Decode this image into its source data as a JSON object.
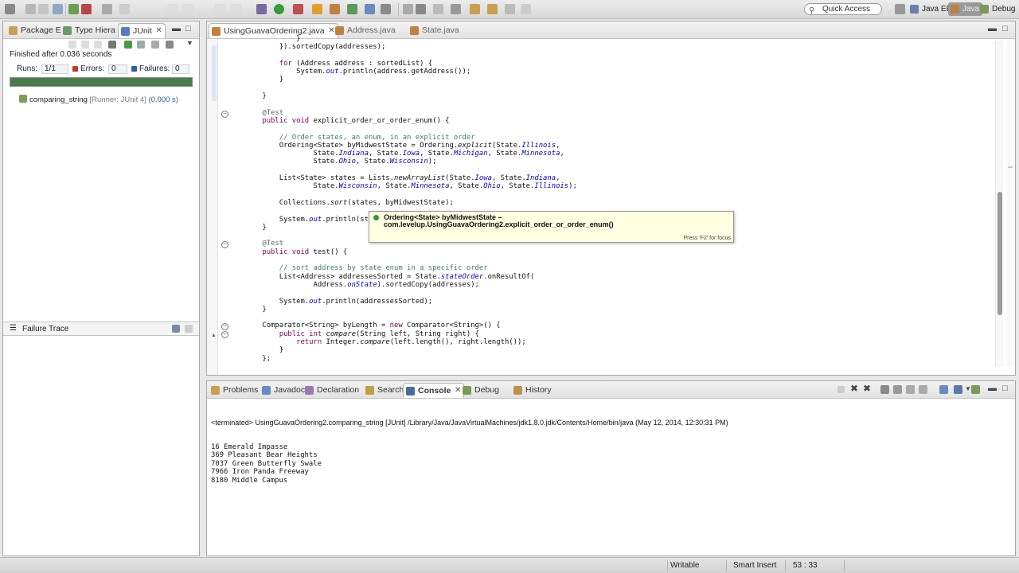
{
  "toolbar": {
    "quick_access_placeholder": "Quick Access",
    "perspectives": [
      {
        "label": "Java EE",
        "icon": "java-ee-icon"
      },
      {
        "label": "Java",
        "icon": "java-perspective-icon"
      },
      {
        "label": "Debug",
        "icon": "debug-perspective-icon"
      }
    ]
  },
  "junit_panel": {
    "tabs": [
      {
        "label": "Package E"
      },
      {
        "label": "Type Hiera"
      },
      {
        "label": "JUnit"
      }
    ],
    "status": "Finished after 0.036 seconds",
    "runs_label": "Runs:",
    "runs_value": "1/1",
    "errors_label": "Errors:",
    "errors_value": "0",
    "failures_label": "Failures:",
    "failures_value": "0",
    "progress": 1.0,
    "progress_color": "#4d7a4d",
    "test_name": "comparing_string",
    "test_meta": "[Runner: JUnit 4]",
    "test_time": "(0.000 s)",
    "failure_trace_label": "Failure Trace"
  },
  "editor": {
    "tabs": [
      {
        "label": "UsingGuavaOrdering2.java"
      },
      {
        "label": "Address.java"
      },
      {
        "label": "State.java"
      }
    ],
    "lines": [
      "            }",
      "        }).sortedCopy(addresses);",
      "",
      "        for (Address address : sortedList) {",
      "            System.out.println(address.getAddress());",
      "        }",
      "",
      "    }",
      "",
      "    @Test",
      "    public void explicit_order_or_order_enum() {",
      "",
      "        // Order states, an enum, in an explicit order",
      "        Ordering<State> byMidwestState = Ordering.explicit(State.Illinois,",
      "                State.Indiana, State.Iowa, State.Michigan, State.Minnesota,",
      "                State.Ohio, State.Wisconsin);",
      "",
      "        List<State> states = Lists.newArrayList(State.Iowa, State.Indiana,",
      "                State.Wisconsin, State.Minnesota, State.Ohio, State.Illinois);",
      "",
      "        Collections.sort(states, byMidwestState);",
      "",
      "        System.out.println(states",
      "    }",
      "",
      "    @Test",
      "    public void test() {",
      "",
      "        // sort address by state enum in a specific order",
      "        List<Address> addressesSorted = State.stateOrder.onResultOf(",
      "                Address.onState).sortedCopy(addresses);",
      "",
      "        System.out.println(addressesSorted);",
      "    }",
      "",
      "    Comparator<String> byLength = new Comparator<String>() {",
      "        public int compare(String left, String right) {",
      "            return Integer.compare(left.length(), right.length());",
      "        }",
      "    };"
    ],
    "tooltip": {
      "line1": "Ordering<State> byMidwestState –",
      "line2": "com.levelup.UsingGuavaOrdering2.explicit_order_or_order_enum()",
      "hint": "Press 'F2' for focus"
    }
  },
  "console_panel": {
    "tabs": [
      {
        "label": "Problems"
      },
      {
        "label": "Javadoc"
      },
      {
        "label": "Declaration"
      },
      {
        "label": "Search"
      },
      {
        "label": "Console"
      },
      {
        "label": "Debug"
      },
      {
        "label": "History"
      }
    ],
    "terminated": "<terminated> UsingGuavaOrdering2.comparing_string [JUnit] /Library/Java/JavaVirtualMachines/jdk1.8.0.jdk/Contents/Home/bin/java (May 12, 2014, 12:30:31 PM)",
    "output": [
      "16 Emerald Impasse",
      "369 Pleasant Bear Heights",
      "7037 Green Butterfly Swale",
      "7966 Iron Panda Freeway",
      "8180 Middle Campus"
    ]
  },
  "statusbar": {
    "writable": "Writable",
    "insert_mode": "Smart Insert",
    "position": "53 : 33"
  }
}
